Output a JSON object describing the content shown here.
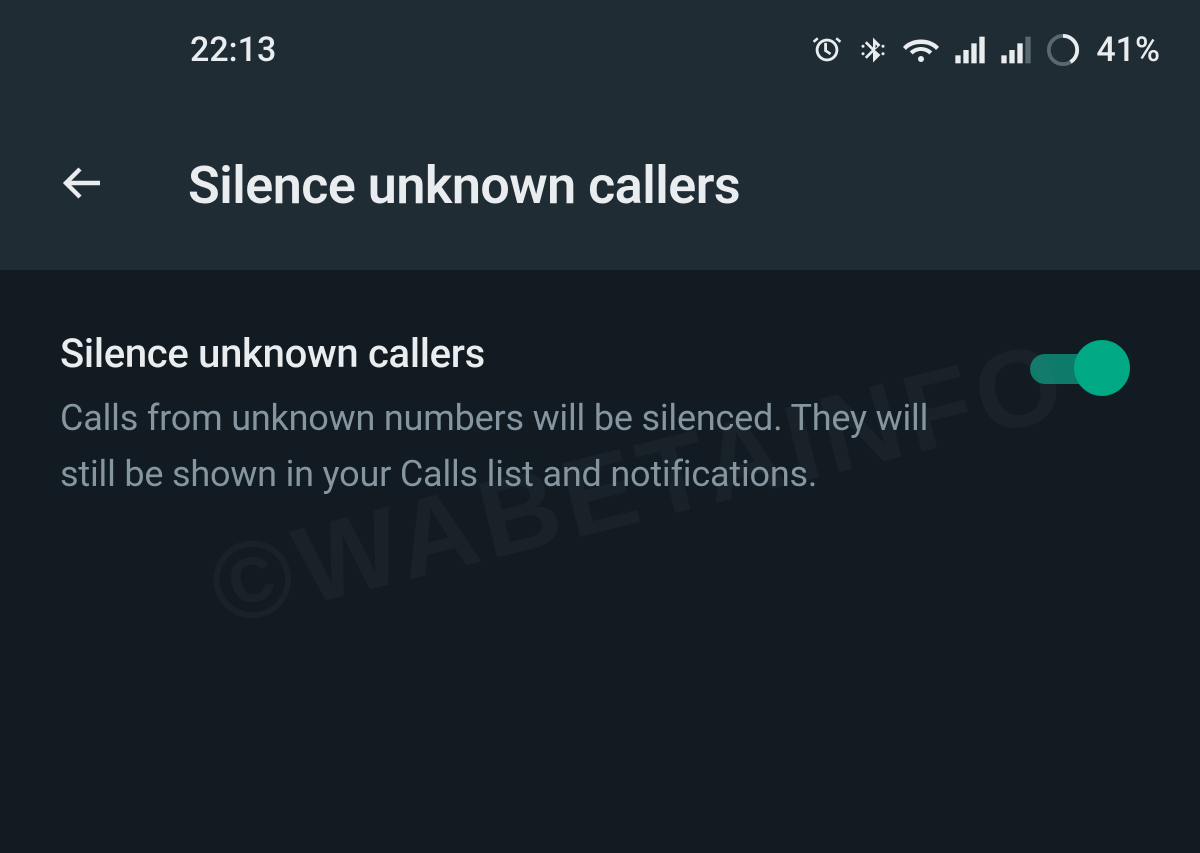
{
  "status_bar": {
    "time": "22:13",
    "battery_percent": "41%"
  },
  "app_bar": {
    "title": "Silence unknown callers"
  },
  "setting": {
    "title": "Silence unknown callers",
    "description": "Calls from unknown numbers will be silenced. They will still be shown in your Calls list and notifications.",
    "toggle_on": true
  },
  "watermark": "©WABETAINFO"
}
